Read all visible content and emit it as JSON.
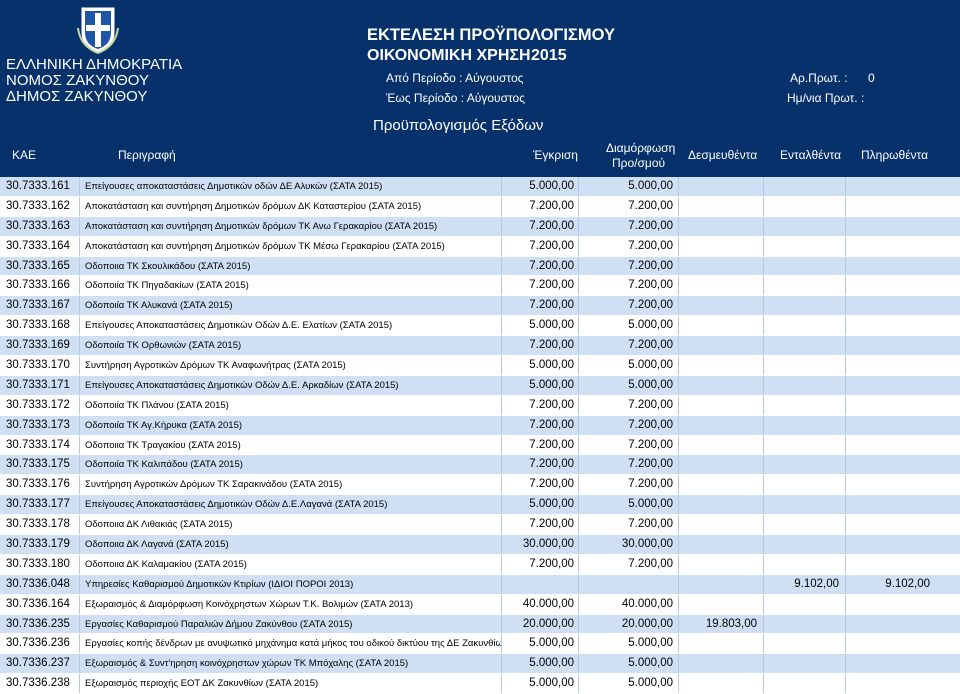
{
  "header": {
    "emblem": "greek-coat-of-arms",
    "gov_lines": [
      "ΕΛΛΗΝΙΚΗ ΔΗΜΟΚΡΑΤΙΑ",
      "ΝΟΜΟΣ ΖΑΚΥΝΘΟΥ",
      "ΔΗΜΟΣ ΖΑΚΥΝΘΟΥ"
    ],
    "title": "ΕΚΤΕΛΕΣΗ ΠΡΟΫΠΟΛΟΓΙΣΜΟΥ",
    "fiscal_year_label": "ΟΙΚΟΝΟΜΙΚΗ ΧΡΗΣΗ",
    "fiscal_year": "2015",
    "from_period": "Από Περίοδο : Αύγουστος",
    "to_period": "Έως Περίοδο : Αύγουστος",
    "protocol_no_label": "Αρ.Πρωτ. :",
    "protocol_no": "0",
    "protocol_date_label": "Ημ/νια Πρωτ. :",
    "budget_title": "Προϋπολογισμός Εξόδων",
    "colors": {
      "header_bg": "#06316a",
      "row_alt": "#cfe0f4"
    }
  },
  "columns": {
    "kae": "ΚΑΕ",
    "description": "Περιγραφή",
    "approval": "Έγκριση",
    "shaping_1": "Διαμόρφωση",
    "shaping_2": "Προ/σμού",
    "committed": "Δεσμευθέντα",
    "certified": "Ενταλθέντα",
    "paid": "Πληρωθέντα"
  },
  "rows": [
    {
      "kae": "30.7333.161",
      "desc": "Επείγουσες αποκαταστάσεις Δημοτικών οδών ΔΕ Αλυκών (ΣΑΤΑ 2015)",
      "approval": "5.000,00",
      "shaping": "5.000,00",
      "committed": "",
      "certified": "",
      "paid": ""
    },
    {
      "kae": "30.7333.162",
      "desc": "Αποκατάσταση και συντήρηση Δημοτικών δρόμων ΔΚ Καταστερίου (ΣΑΤΑ 2015)",
      "approval": "7.200,00",
      "shaping": "7.200,00",
      "committed": "",
      "certified": "",
      "paid": ""
    },
    {
      "kae": "30.7333.163",
      "desc": "Αποκατάσταση και συντήρηση Δημοτικών δρόμων ΤΚ Ανω Γερακαρίου (ΣΑΤΑ 2015)",
      "approval": "7.200,00",
      "shaping": "7.200,00",
      "committed": "",
      "certified": "",
      "paid": ""
    },
    {
      "kae": "30.7333.164",
      "desc": "Αποκατάσταση και συντήρηση Δημοτικών δρόμων ΤΚ Μέσω Γερακαρίου (ΣΑΤΑ 2015)",
      "approval": "7.200,00",
      "shaping": "7.200,00",
      "committed": "",
      "certified": "",
      "paid": ""
    },
    {
      "kae": "30.7333.165",
      "desc": "Οδοποιια ΤΚ Σκουλικάδου (ΣΑΤΑ 2015)",
      "approval": "7.200,00",
      "shaping": "7.200,00",
      "committed": "",
      "certified": "",
      "paid": ""
    },
    {
      "kae": "30.7333.166",
      "desc": "Οδοποιία ΤΚ Πηγαδακίων (ΣΑΤΑ 2015)",
      "approval": "7.200,00",
      "shaping": "7.200,00",
      "committed": "",
      "certified": "",
      "paid": ""
    },
    {
      "kae": "30.7333.167",
      "desc": "Οδοποιία ΤΚ Αλυκανά (ΣΑΤΑ 2015)",
      "approval": "7.200,00",
      "shaping": "7.200,00",
      "committed": "",
      "certified": "",
      "paid": ""
    },
    {
      "kae": "30.7333.168",
      "desc": "Επείγουσες Αποκαταστάσεις Δημοτικών Οδών Δ.Ε. Ελατίων (ΣΑΤΑ 2015)",
      "approval": "5.000,00",
      "shaping": "5.000,00",
      "committed": "",
      "certified": "",
      "paid": ""
    },
    {
      "kae": "30.7333.169",
      "desc": "Οδοποιία ΤΚ Ορθωνιών (ΣΑΤΑ 2015)",
      "approval": "7.200,00",
      "shaping": "7.200,00",
      "committed": "",
      "certified": "",
      "paid": ""
    },
    {
      "kae": "30.7333.170",
      "desc": "Συντήρηση Αγροτικών Δρόμων ΤΚ Αναφωνήτρας (ΣΑΤΑ 2015)",
      "approval": "5.000,00",
      "shaping": "5.000,00",
      "committed": "",
      "certified": "",
      "paid": ""
    },
    {
      "kae": "30.7333.171",
      "desc": "Επείγουσες Αποκαταστάσεις Δημοτικών Οδών Δ.Ε. Αρκαδίων (ΣΑΤΑ 2015)",
      "approval": "5.000,00",
      "shaping": "5.000,00",
      "committed": "",
      "certified": "",
      "paid": ""
    },
    {
      "kae": "30.7333.172",
      "desc": "Οδοποιία ΤΚ Πλάνου (ΣΑΤΑ 2015)",
      "approval": "7.200,00",
      "shaping": "7.200,00",
      "committed": "",
      "certified": "",
      "paid": ""
    },
    {
      "kae": "30.7333.173",
      "desc": "Οδοποιία ΤΚ Αγ.Κήρυκα (ΣΑΤΑ 2015)",
      "approval": "7.200,00",
      "shaping": "7.200,00",
      "committed": "",
      "certified": "",
      "paid": ""
    },
    {
      "kae": "30.7333.174",
      "desc": "Οδοποιια ΤΚ Τραγακίου (ΣΑΤΑ 2015)",
      "approval": "7.200,00",
      "shaping": "7.200,00",
      "committed": "",
      "certified": "",
      "paid": ""
    },
    {
      "kae": "30.7333.175",
      "desc": "Οδοποιία ΤΚ Καλιπάδου (ΣΑΤΑ 2015)",
      "approval": "7.200,00",
      "shaping": "7.200,00",
      "committed": "",
      "certified": "",
      "paid": ""
    },
    {
      "kae": "30.7333.176",
      "desc": "Συντήρηση Αγροτικών Δρόμων ΤΚ Σαρακινάδου (ΣΑΤΑ 2015)",
      "approval": "7.200,00",
      "shaping": "7.200,00",
      "committed": "",
      "certified": "",
      "paid": ""
    },
    {
      "kae": "30.7333.177",
      "desc": "Επείγουσες Αποκαταστάσεις Δημοτικών Οδών Δ.Ε.Λαγανά (ΣΑΤΑ 2015)",
      "approval": "5.000,00",
      "shaping": "5.000,00",
      "committed": "",
      "certified": "",
      "paid": ""
    },
    {
      "kae": "30.7333.178",
      "desc": "Οδοποιια ΔΚ Λιθακιάς (ΣΑΤΑ 2015)",
      "approval": "7.200,00",
      "shaping": "7.200,00",
      "committed": "",
      "certified": "",
      "paid": ""
    },
    {
      "kae": "30.7333.179",
      "desc": "Οδοποιια ΔΚ Λαγανά (ΣΑΤΑ 2015)",
      "approval": "30.000,00",
      "shaping": "30.000,00",
      "committed": "",
      "certified": "",
      "paid": ""
    },
    {
      "kae": "30.7333.180",
      "desc": "Οδοποιια ΔΚ Καλαμακίου (ΣΑΤΑ 2015)",
      "approval": "7.200,00",
      "shaping": "7.200,00",
      "committed": "",
      "certified": "",
      "paid": ""
    },
    {
      "kae": "30.7336.048",
      "desc": "Υπηρεσίες Καθαρισμού Δημοτικών Κτιρίων (ΙΔΙΟΙ ΠΟΡΟΙ 2013)",
      "approval": "",
      "shaping": "",
      "committed": "",
      "certified": "9.102,00",
      "paid": "9.102,00"
    },
    {
      "kae": "30.7336.164",
      "desc": "Εξωραισμός & Διαμόρφωση Κοινόχρηστων Χώρων Τ.Κ. Βολιμών (ΣΑΤΑ 2013)",
      "approval": "40.000,00",
      "shaping": "40.000,00",
      "committed": "",
      "certified": "",
      "paid": ""
    },
    {
      "kae": "30.7336.235",
      "desc": "Εργασίες Καθαρισμού Παραλιών Δήμου Ζακύνθου (ΣΑΤΑ 2015)",
      "approval": "20.000,00",
      "shaping": "20.000,00",
      "committed": "19.803,00",
      "certified": "",
      "paid": ""
    },
    {
      "kae": "30.7336.236",
      "desc": "Εργασίες κοπής δένδρων με ανυψωτικό μηχάνημα κατά μήκος του οδικού δικτύου της ΔΕ Ζακυνθίων",
      "approval": "5.000,00",
      "shaping": "5.000,00",
      "committed": "",
      "certified": "",
      "paid": ""
    },
    {
      "kae": "30.7336.237",
      "desc": "Εξωραισμός & Συντ'ηρηση κοινόχρηστων χώρων ΤΚ Μπόχαλης (ΣΑΤΑ 2015)",
      "approval": "5.000,00",
      "shaping": "5.000,00",
      "committed": "",
      "certified": "",
      "paid": ""
    },
    {
      "kae": "30.7336.238",
      "desc": "Εξωραισμός περιοχής ΕΟΤ ΔΚ Ζακυνθίων (ΣΑΤΑ 2015)",
      "approval": "5.000,00",
      "shaping": "5.000,00",
      "committed": "",
      "certified": "",
      "paid": ""
    }
  ]
}
